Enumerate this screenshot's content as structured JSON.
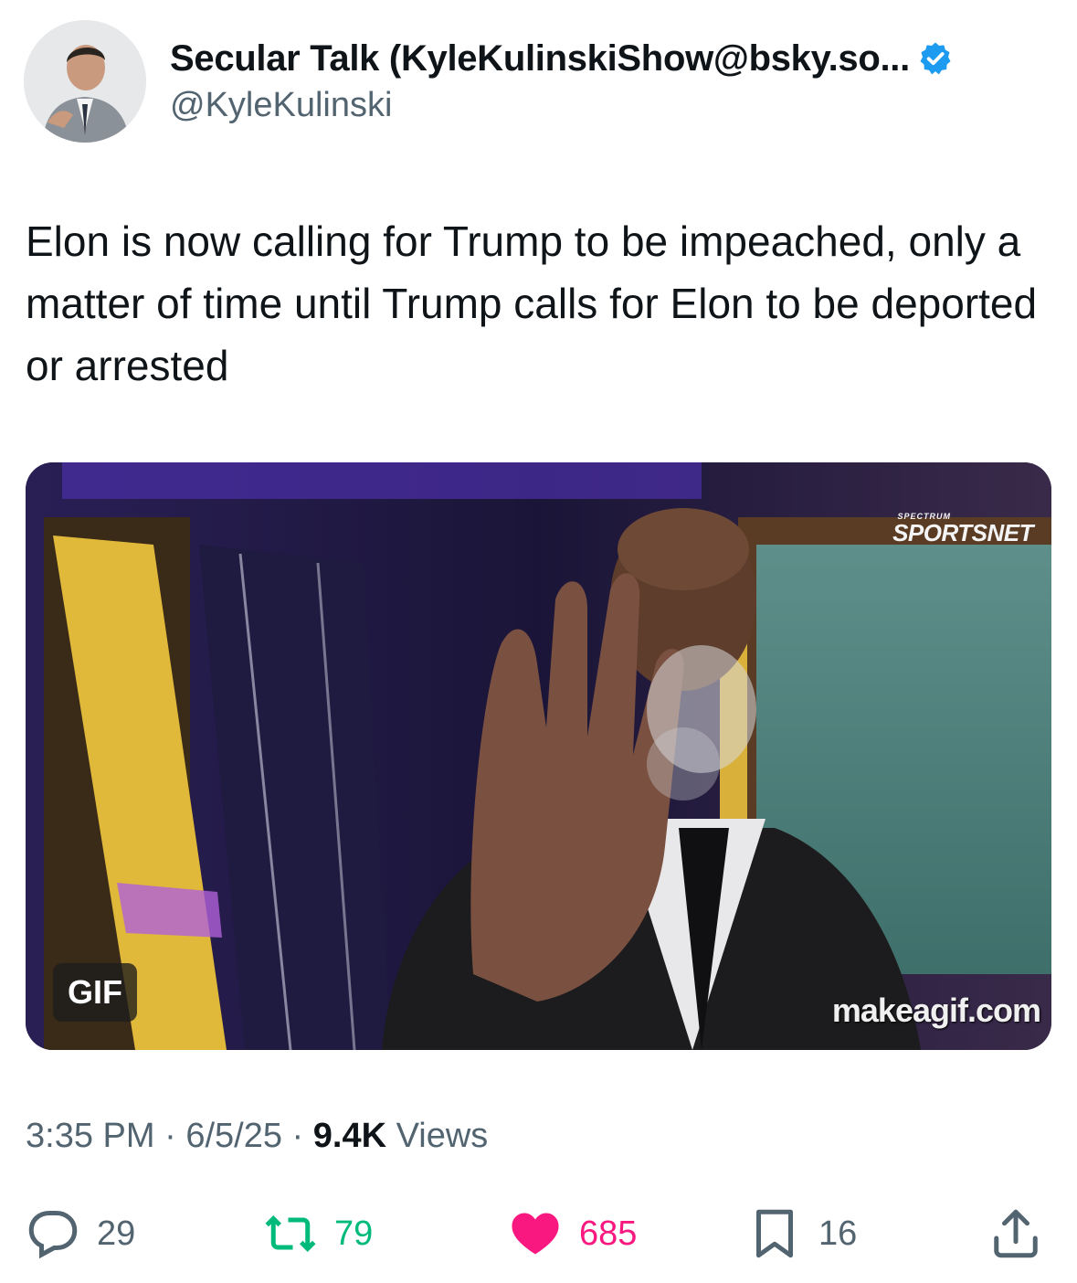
{
  "author": {
    "display_name": "Secular Talk (KyleKulinskiShow@bsky.so...",
    "handle": "@KyleKulinski",
    "verified": true
  },
  "tweet": {
    "text": "Elon is now calling for Trump to be impeached, only a matter of time until Trump calls for Elon to be deported or arrested"
  },
  "media": {
    "badge": "GIF",
    "watermark": "makeagif.com",
    "logo_top": "SPECTRUM",
    "logo_main": "SPORTSNET"
  },
  "meta": {
    "time": "3:35 PM",
    "sep1": " · ",
    "date": "6/5/25",
    "sep2": " · ",
    "views_count": "9.4K",
    "views_label": " Views"
  },
  "actions": {
    "replies": "29",
    "reposts": "79",
    "likes": "685",
    "bookmarks": "16"
  },
  "colors": {
    "verified": "#1d9bf0",
    "repost": "#00ba7c",
    "like": "#f91880",
    "muted": "#536471"
  }
}
